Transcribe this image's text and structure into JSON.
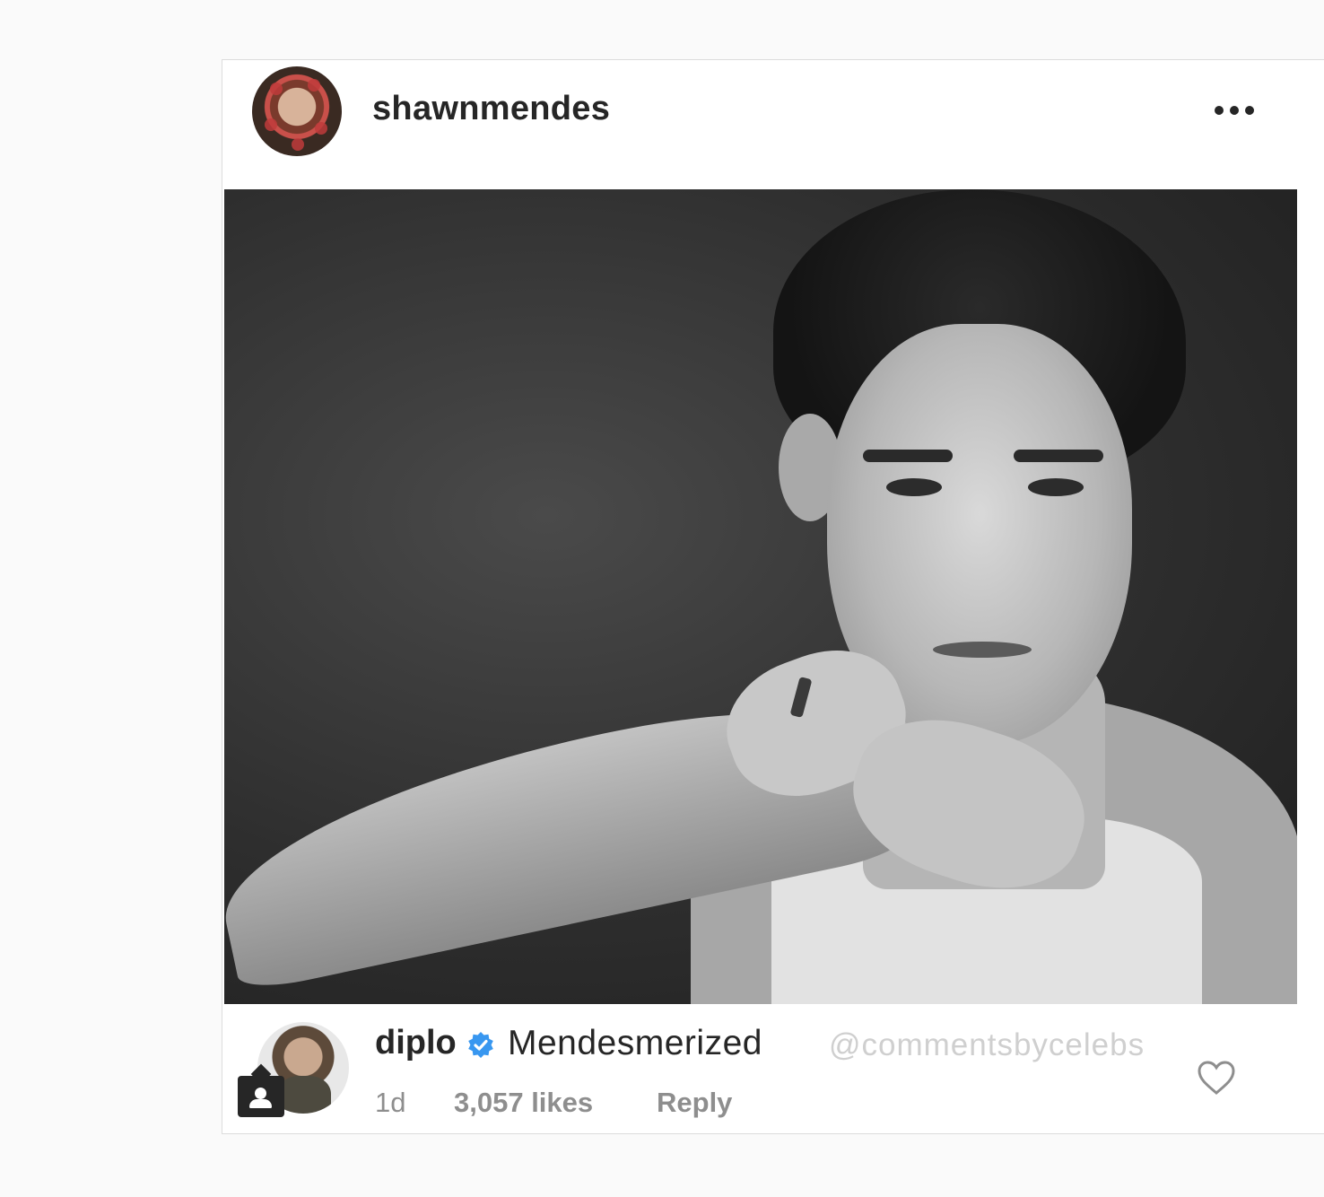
{
  "post": {
    "username": "shawnmendes",
    "more_icon": "more-options-icon"
  },
  "comment": {
    "username": "diplo",
    "verified_icon": "verified-badge-icon",
    "text": "Mendesmerized",
    "watermark": "@commentsbycelebs",
    "time": "1d",
    "likes": "3,057 likes",
    "reply_label": "Reply",
    "like_icon": "heart-icon",
    "tag_icon": "tagged-user-icon"
  },
  "colors": {
    "text_primary": "#262626",
    "text_secondary": "#8e8e8e",
    "verified_blue": "#3897f0",
    "watermark": "#cfcfcf"
  }
}
